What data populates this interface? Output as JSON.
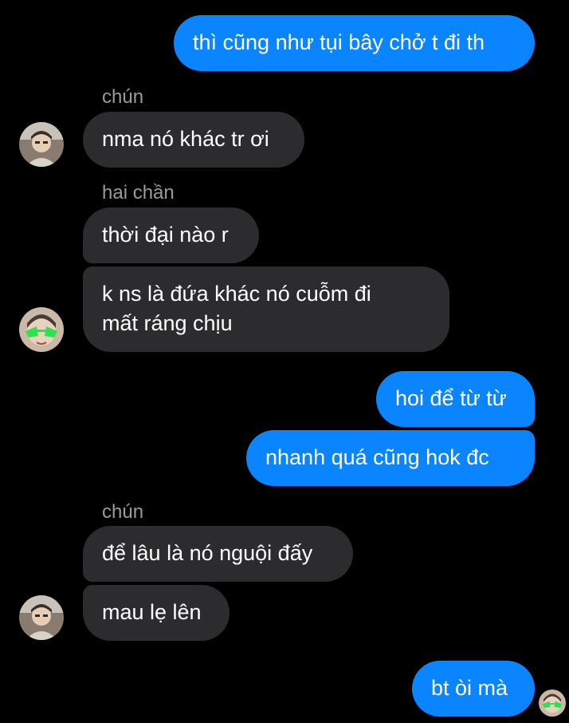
{
  "messages": [
    {
      "text": "thì cũng như tụi bây chở t đi th"
    },
    {
      "sender": "chún",
      "text": "nma nó khác tr ơi"
    },
    {
      "sender": "hai chần",
      "text": "thời đại nào r"
    },
    {
      "text_line1": "k ns là đứa khác nó cuỗm đi",
      "text_line2": "mất ráng chịu"
    },
    {
      "text": "hoi để từ từ"
    },
    {
      "text": "nhanh quá cũng hok đc"
    },
    {
      "sender": "chún",
      "text": "để lâu là nó nguội đấy"
    },
    {
      "text": "mau lẹ lên"
    },
    {
      "text": "bt òi mà"
    }
  ],
  "colors": {
    "background": "#000000",
    "outgoing_bubble": "#0A84FF",
    "incoming_bubble": "#2C2C2E",
    "sender_name": "#9A9A9F"
  }
}
